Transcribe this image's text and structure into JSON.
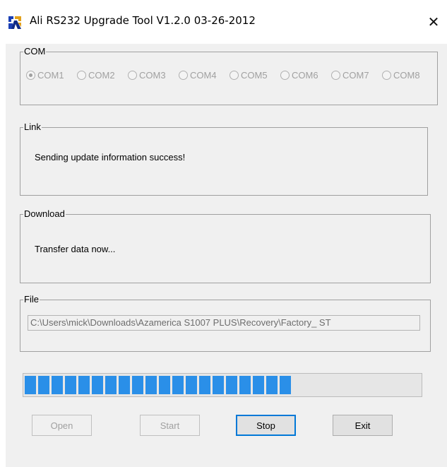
{
  "window": {
    "title": "Ali RS232 Upgrade Tool   V1.2.0  03-26-2012",
    "close_glyph": "✕"
  },
  "com_group": {
    "legend": "COM",
    "options": [
      {
        "label": "COM1",
        "checked": true
      },
      {
        "label": "COM2",
        "checked": false
      },
      {
        "label": "COM3",
        "checked": false
      },
      {
        "label": "COM4",
        "checked": false
      },
      {
        "label": "COM5",
        "checked": false
      },
      {
        "label": "COM6",
        "checked": false
      },
      {
        "label": "COM7",
        "checked": false
      },
      {
        "label": "COM8",
        "checked": false
      }
    ],
    "enabled": false
  },
  "link_group": {
    "legend": "Link",
    "message": "Sending update information success!"
  },
  "download_group": {
    "legend": "Download",
    "message": "Transfer data now..."
  },
  "file_group": {
    "legend": "File",
    "path": "C:\\Users\\mick\\Downloads\\Azamerica S1007 PLUS\\Recovery\\Factory_ ST"
  },
  "progress": {
    "value_percent": 68,
    "color": "#2a8fe8"
  },
  "buttons": {
    "open": {
      "label": "Open",
      "enabled": false
    },
    "start": {
      "label": "Start",
      "enabled": false
    },
    "stop": {
      "label": "Stop",
      "enabled": true,
      "focused": true
    },
    "exit": {
      "label": "Exit",
      "enabled": true
    }
  },
  "icons": {
    "app": "ali-app-icon",
    "close": "close-icon"
  }
}
